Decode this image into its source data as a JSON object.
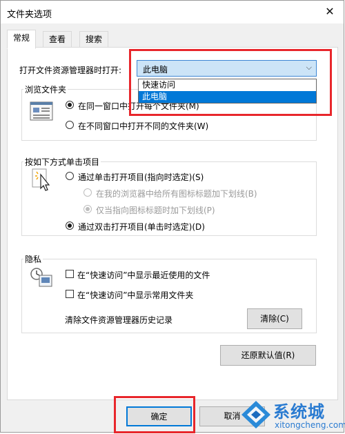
{
  "window": {
    "title": "文件夹选项",
    "close_glyph": "✕"
  },
  "tabs": [
    {
      "label": "常规",
      "active": true
    },
    {
      "label": "查看",
      "active": false
    },
    {
      "label": "搜索",
      "active": false
    }
  ],
  "open_explorer": {
    "label": "打开文件资源管理器时打开:",
    "selected": "此电脑",
    "arrow_glyph": "⌵",
    "options": [
      "快速访问",
      "此电脑"
    ]
  },
  "browse_folders": {
    "legend": "浏览文件夹",
    "options": [
      {
        "label": "在同一窗口中打开每个文件夹(M)",
        "checked": true
      },
      {
        "label": "在不同窗口中打开不同的文件夹(W)",
        "checked": false
      }
    ]
  },
  "click_items": {
    "legend": "按如下方式单击项目",
    "single_click": {
      "label": "通过单击打开项目(指向时选定)(S)",
      "checked": false
    },
    "underline_all": {
      "label": "在我的浏览器中给所有图标标题加下划线(B)",
      "checked": false
    },
    "underline_point": {
      "label": "仅当指向图标标题时加下划线(P)",
      "checked": true
    },
    "double_click": {
      "label": "通过双击打开项目(单击时选定)(D)",
      "checked": true
    }
  },
  "privacy": {
    "legend": "隐私",
    "show_recent_files": "在“快速访问”中显示最近使用的文件",
    "show_frequent_folders": "在“快速访问”中显示常用文件夹",
    "clear_history_label": "清除文件资源管理器历史记录",
    "clear_button": "清除(C)"
  },
  "restore_defaults_button": "还原默认值(R)",
  "footer": {
    "ok": "确定",
    "cancel": "取消"
  },
  "watermark": {
    "brand": "系统城",
    "url": "xitongcheng.com"
  },
  "colors": {
    "highlight_red": "#e8262b",
    "accent_blue": "#0078d7",
    "combo_bg": "#cce4f7"
  }
}
